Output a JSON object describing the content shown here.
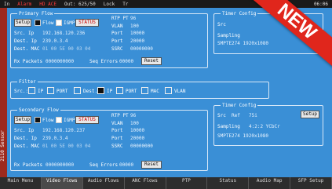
{
  "topbar": {
    "items": [
      "In",
      "Alarm",
      "HD ACE",
      "Out: 625/50",
      "Lock",
      "Tr"
    ],
    "time": "06:06"
  },
  "sidebar_label": "2110 Sensor",
  "primary": {
    "title": "Primary Flow",
    "setup": "Setup",
    "flow": "Flow",
    "igmp": "IGMP",
    "status": "STATUS",
    "src_ip_lbl": "Src. Ip",
    "src_ip": "192.168.120.236",
    "dest_ip_lbl": "Dest. Ip",
    "dest_ip": "239.0.3.4",
    "dest_mac_lbl": "Dest. MAC",
    "dest_mac": "01 00 5E 00 03 04",
    "rtp_lbl": "RTP PT",
    "rtp": "96",
    "vlan_lbl": "VLAN",
    "vlan": "100",
    "port1_lbl": "Port",
    "port1": "10000",
    "port2_lbl": "Port",
    "port2": "20000",
    "ssrc_lbl": "SSRC",
    "ssrc": "00000000",
    "rx_lbl": "Rx Packets",
    "rx": "0000000000",
    "seq_lbl": "Seq Errors",
    "seq": "00000",
    "reset": "Reset"
  },
  "filter": {
    "title": "Filter",
    "src_lbl": "Src.:",
    "ip1": "IP",
    "port1": "PORT",
    "dest_lbl": "Dest.",
    "ip2": "IP",
    "port2": "PORT",
    "mac": "MAC",
    "vlan": "VLAN"
  },
  "secondary": {
    "title": "Secondary Flow",
    "setup": "Setup",
    "flow": "Flow",
    "igmp": "IGMP",
    "status": "STATUS",
    "src_ip_lbl": "Src. Ip",
    "src_ip": "192.168.120.237",
    "dest_ip_lbl": "Dest. Ip",
    "dest_ip": "239.0.3.4",
    "dest_mac_lbl": "Dest. MAC",
    "dest_mac": "01 00 5E 00 03 04",
    "rtp_lbl": "RTP PT",
    "rtp": "96",
    "vlan_lbl": "VLAN",
    "vlan": "100",
    "port1_lbl": "Port",
    "port1": "10000",
    "port2_lbl": "Port",
    "port2": "20000",
    "ssrc_lbl": "SSRC",
    "ssrc": "00000000",
    "rx_lbl": "Rx Packets",
    "rx": "0000000000",
    "seq_lbl": "Seq Errors",
    "seq": "00000",
    "reset": "Reset"
  },
  "timer_top": {
    "title": "Timer Config",
    "line1": "Src",
    "line2": "Sampling",
    "line3": "SMPTE274 1920x1080"
  },
  "timer_bottom": {
    "title": "Timer Config",
    "src_lbl": "Src",
    "src": "Ref",
    "fps": "75i",
    "setup": "Setup",
    "sampling_lbl": "Sampling",
    "sampling": "4:2:2 YCbCr",
    "format": "SMPTE274 1920x1080"
  },
  "tabs": [
    {
      "label": "Main Menu"
    },
    {
      "label": "Video Flows"
    },
    {
      "label": "Audio Flows"
    },
    {
      "label": "ANC Flows"
    },
    {
      "label": "PTP"
    },
    {
      "label": "Status"
    },
    {
      "label": "Audio Map"
    },
    {
      "label": "SFP Setup"
    }
  ],
  "ribbon": "NEW"
}
